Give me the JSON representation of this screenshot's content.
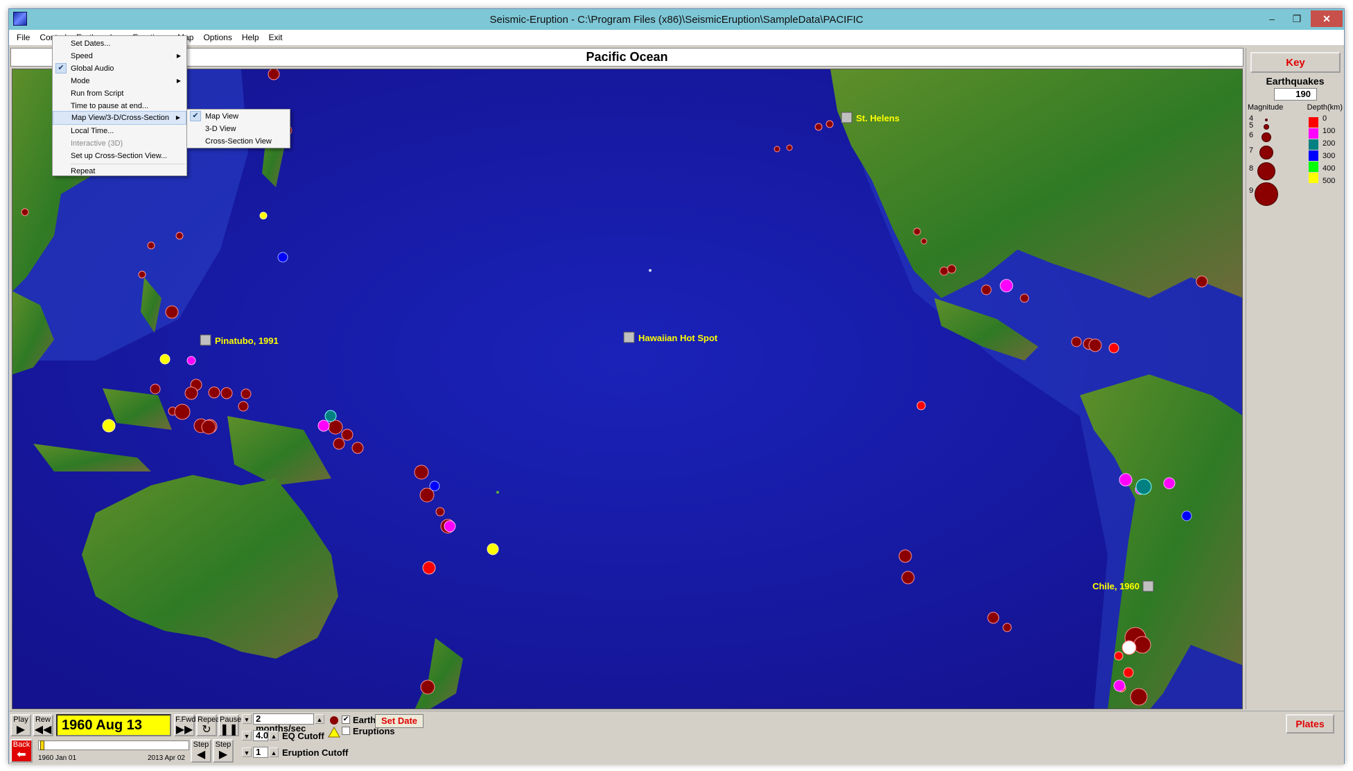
{
  "window": {
    "title": "Seismic-Eruption - C:\\Program Files (x86)\\SeismicEruption\\SampleData\\PACIFIC",
    "minimize_glyph": "–",
    "maximize_glyph": "❐",
    "close_glyph": "✕"
  },
  "menubar": [
    "File",
    "Control",
    "Earthquakes",
    "Eruptions",
    "Map",
    "Options",
    "Help",
    "Exit"
  ],
  "control_menu": {
    "items": [
      {
        "label": "Set Dates..."
      },
      {
        "label": "Speed",
        "submenu": true
      },
      {
        "label": "Global Audio",
        "checked": true
      },
      {
        "label": "Mode",
        "submenu": true
      },
      {
        "label": "Run from Script"
      },
      {
        "label": "Time to pause at end..."
      },
      {
        "label": "Map View/3-D/Cross-Section",
        "submenu": true,
        "highlighted": true
      },
      {
        "label": "Local Time..."
      },
      {
        "label": "Interactive (3D)",
        "disabled": true
      },
      {
        "label": "Set up Cross-Section View..."
      },
      {
        "label": "Repeat"
      }
    ],
    "submenu_view": [
      {
        "label": "Map View",
        "checked": true
      },
      {
        "label": "3-D View"
      },
      {
        "label": "Cross-Section View"
      }
    ]
  },
  "map": {
    "title": "Pacific Ocean",
    "volcano_labels": [
      "St. Helens",
      "Pinatubo, 1991",
      "Hawaiian Hot Spot",
      "Chile, 1960"
    ]
  },
  "key": {
    "button": "Key",
    "heading": "Earthquakes",
    "count": "190",
    "magnitude_label": "Magnitude",
    "depth_label": "Depth(km)",
    "magnitudes": [
      "4",
      "5",
      "6",
      "7",
      "8",
      "9"
    ],
    "depths": [
      {
        "value": "0",
        "color": "#ff0000"
      },
      {
        "value": "100",
        "color": "#ff00ff"
      },
      {
        "value": "200",
        "color": "#008080"
      },
      {
        "value": "300",
        "color": "#0000ff"
      },
      {
        "value": "400",
        "color": "#00ff00"
      },
      {
        "value": "500",
        "color": "#ffff00"
      }
    ]
  },
  "controls": {
    "play": "Play",
    "rew": "Rew",
    "current_date": "1960 Aug 13",
    "ffwd": "F.Fwd",
    "repeat": "Repeat",
    "pause": "Pause",
    "speed": "2 months/sec",
    "earthquakes_label": "Earthquakes",
    "eruptions_label": "Eruptions",
    "set_date": "Set Date",
    "eq_cutoff_value": "4.0",
    "eq_cutoff_label": "EQ Cutoff",
    "eruption_cutoff_value": "1",
    "eruption_cutoff_label": "Eruption Cutoff",
    "step": "Step",
    "back": "Back",
    "start_date": "1960 Jan 01",
    "end_date": "2013 Apr 02",
    "plates": "Plates",
    "slider_position": 0.01
  },
  "colors": {
    "ocean": "#1c1cb0",
    "land": "#3f7d28",
    "quake": "#8b0000",
    "accent_red": "#e00000",
    "date_bg": "#ffff00"
  }
}
